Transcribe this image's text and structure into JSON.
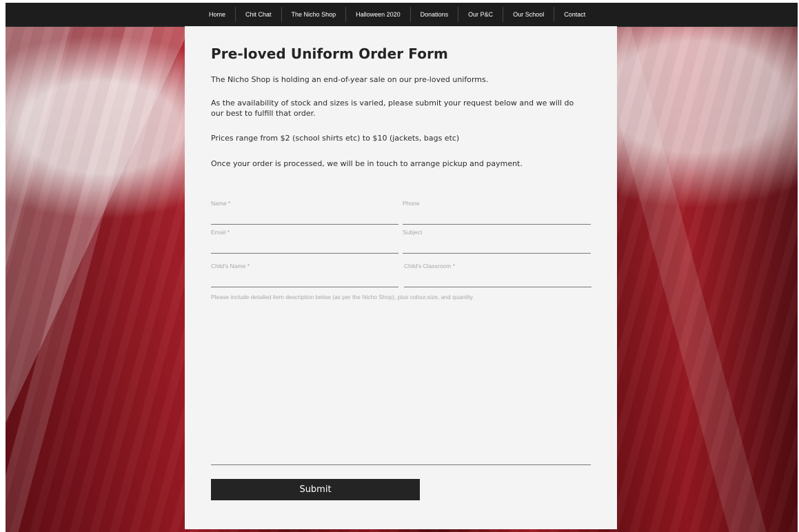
{
  "nav": {
    "items": [
      "Home",
      "Chit Chat",
      "The Nicho Shop",
      "Halloween 2020",
      "Donations",
      "Our P&C",
      "Our School",
      "Contact"
    ]
  },
  "content": {
    "title": "Pre-loved Uniform Order Form",
    "p1": "The Nicho Shop is holding an end-of-year sale on our pre-loved uniforms.",
    "p2": "As the availability of stock and sizes is varied, please submit your request below and we will do our best to fulfill that order.",
    "p3": "Prices range from $2 (school shirts etc) to $10 (jackets, bags etc)",
    "p4": "Once your order is processed, we will be in touch to arrange pickup and payment."
  },
  "form": {
    "name_label": "Name *",
    "phone_label": "Phone",
    "email_label": "Email *",
    "subject_label": "Subject",
    "child_name_label": "Child's Name *",
    "child_classroom_label": "Child's Classroom *",
    "message_label": "Please include detailed item description below (as per the Nicho Shop), plus colour,size, and quantity.",
    "name_value": "",
    "phone_value": "",
    "email_value": "",
    "subject_value": "",
    "child_name_value": "",
    "child_classroom_value": "",
    "message_value": "",
    "submit_label": "Submit"
  },
  "colors": {
    "nav_background": "#1d1d1d",
    "panel_background": "#f4f4f4",
    "submit_background": "#242424",
    "background_red": "#9f1a24"
  }
}
